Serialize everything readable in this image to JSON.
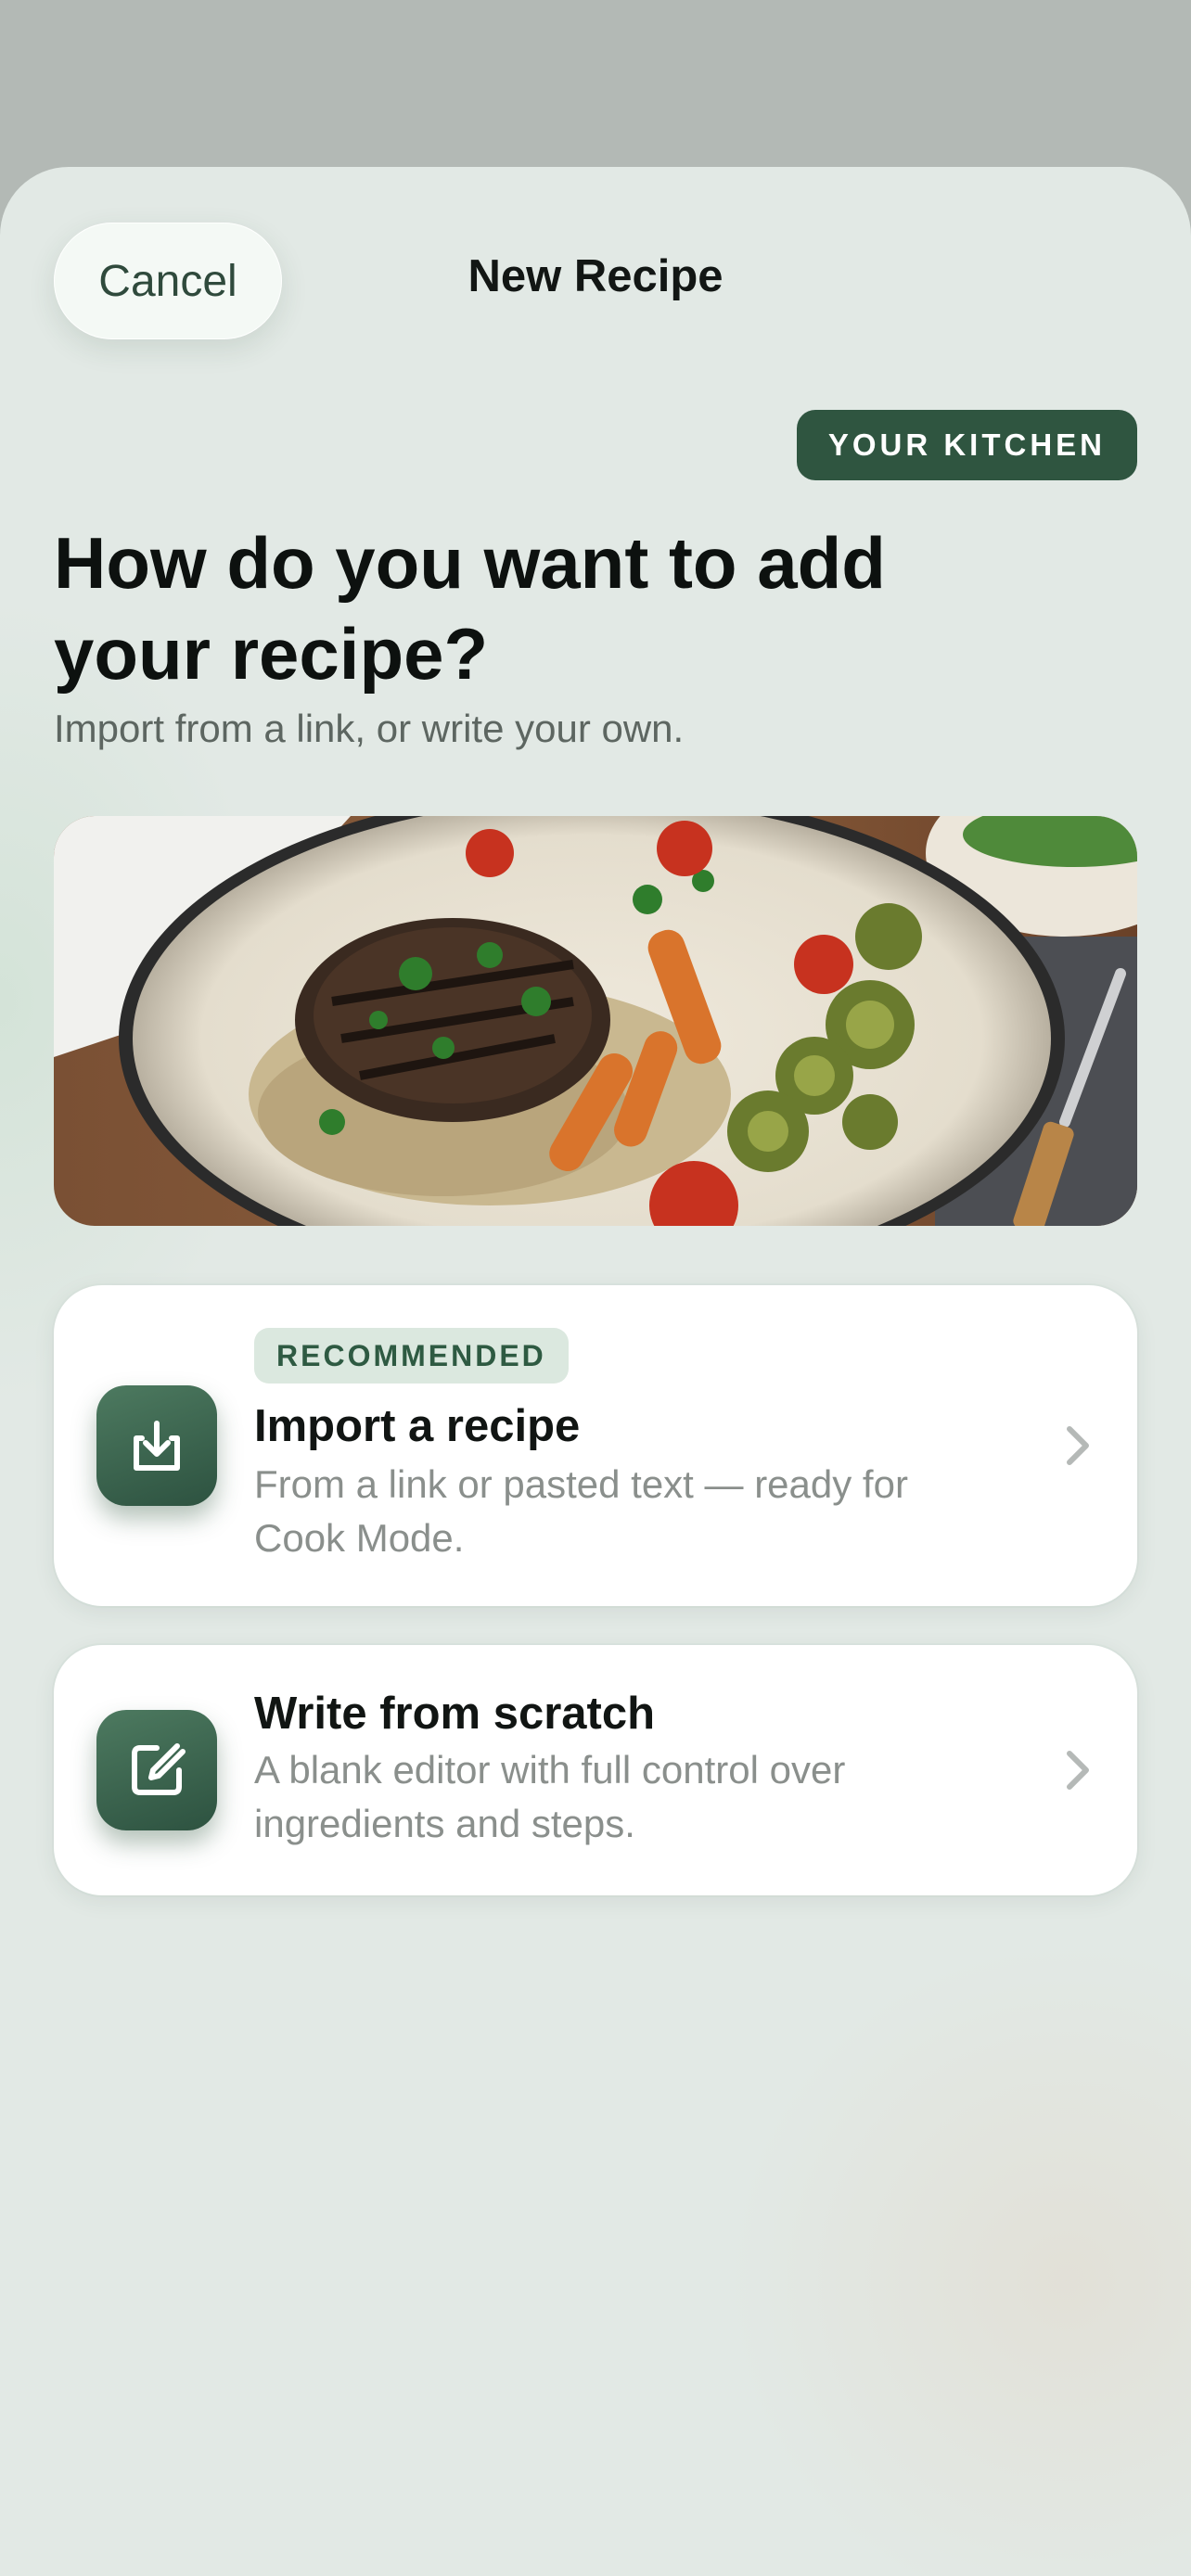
{
  "nav": {
    "cancel_label": "Cancel",
    "title": "New Recipe"
  },
  "badge": "YOUR KITCHEN",
  "headline": "How do you want to add your recipe?",
  "subtitle": "Import from a link, or write your own.",
  "hero_image": {
    "alt": "Plated dish of grilled portobello, grains, roasted carrots, tomatoes and brussels sprouts"
  },
  "options": [
    {
      "pill": "RECOMMENDED",
      "title": "Import a recipe",
      "description": "From a link or pasted text — ready for Cook Mode.",
      "icon": "import-download-icon"
    },
    {
      "title": "Write from scratch",
      "description": "A blank editor with full control over ingredients and steps.",
      "icon": "edit-pencil-icon"
    }
  ],
  "colors": {
    "accent": "#2f5540",
    "sheet": "#e2e9e5",
    "backdrop": "#b3b9b5"
  }
}
